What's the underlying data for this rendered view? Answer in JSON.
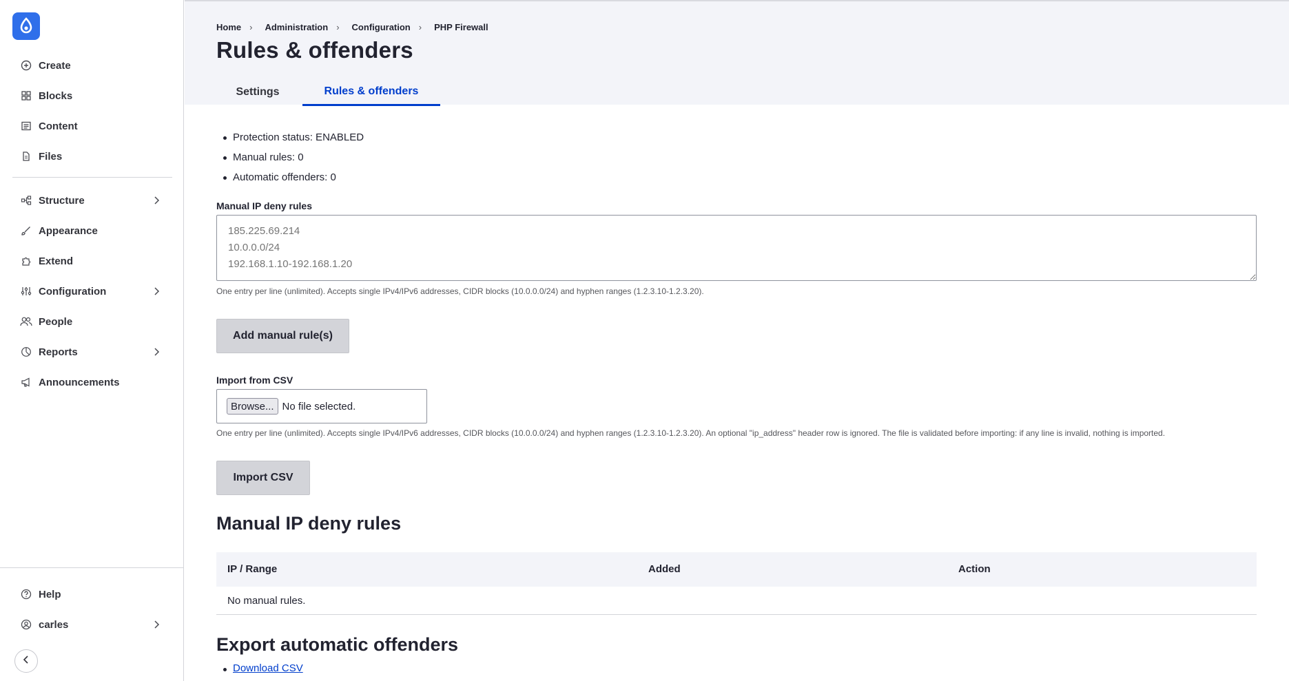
{
  "sidebar": {
    "top_items": [
      {
        "label": "Create",
        "icon": "plus-circle-icon"
      },
      {
        "label": "Blocks",
        "icon": "blocks-icon"
      },
      {
        "label": "Content",
        "icon": "content-icon"
      },
      {
        "label": "Files",
        "icon": "file-icon"
      }
    ],
    "mid_items": [
      {
        "label": "Structure",
        "icon": "structure-icon",
        "has_children": true
      },
      {
        "label": "Appearance",
        "icon": "brush-icon",
        "has_children": false
      },
      {
        "label": "Extend",
        "icon": "puzzle-icon",
        "has_children": false
      },
      {
        "label": "Configuration",
        "icon": "sliders-icon",
        "has_children": true
      },
      {
        "label": "People",
        "icon": "people-icon",
        "has_children": false
      },
      {
        "label": "Reports",
        "icon": "chart-icon",
        "has_children": true
      },
      {
        "label": "Announcements",
        "icon": "megaphone-icon",
        "has_children": false
      }
    ],
    "bottom_items": [
      {
        "label": "Help",
        "icon": "help-icon",
        "has_children": false
      },
      {
        "label": "carles",
        "icon": "user-icon",
        "has_children": true
      }
    ]
  },
  "header": {
    "breadcrumb": [
      "Home",
      "Administration",
      "Configuration",
      "PHP Firewall"
    ],
    "title": "Rules & offenders",
    "tabs": [
      {
        "label": "Settings",
        "active": false
      },
      {
        "label": "Rules & offenders",
        "active": true
      }
    ]
  },
  "status": [
    "Protection status: ENABLED",
    "Manual rules: 0",
    "Automatic offenders: 0"
  ],
  "manual_form": {
    "label": "Manual IP deny rules",
    "placeholder": "185.225.69.214\n10.0.0.0/24\n192.168.1.10-192.168.1.20",
    "help": "One entry per line (unlimited). Accepts single IPv4/IPv6 addresses, CIDR blocks (10.0.0.0/24) and hyphen ranges (1.2.3.10-1.2.3.20).",
    "button": "Add manual rule(s)"
  },
  "csv_form": {
    "label": "Import from CSV",
    "browse": "Browse...",
    "file_status": "No file selected.",
    "help": "One entry per line (unlimited). Accepts single IPv4/IPv6 addresses, CIDR blocks (10.0.0.0/24) and hyphen ranges (1.2.3.10-1.2.3.20). An optional \"ip_address\" header row is ignored. The file is validated before importing: if any line is invalid, nothing is imported.",
    "button": "Import CSV"
  },
  "rules_table": {
    "heading": "Manual IP deny rules",
    "columns": [
      "IP / Range",
      "Added",
      "Action"
    ],
    "empty": "No manual rules."
  },
  "export": {
    "heading": "Export automatic offenders",
    "link": "Download CSV"
  },
  "colors": {
    "accent": "#003ecc",
    "logo": "#2f6fea",
    "header_bg": "#f3f4f9"
  }
}
